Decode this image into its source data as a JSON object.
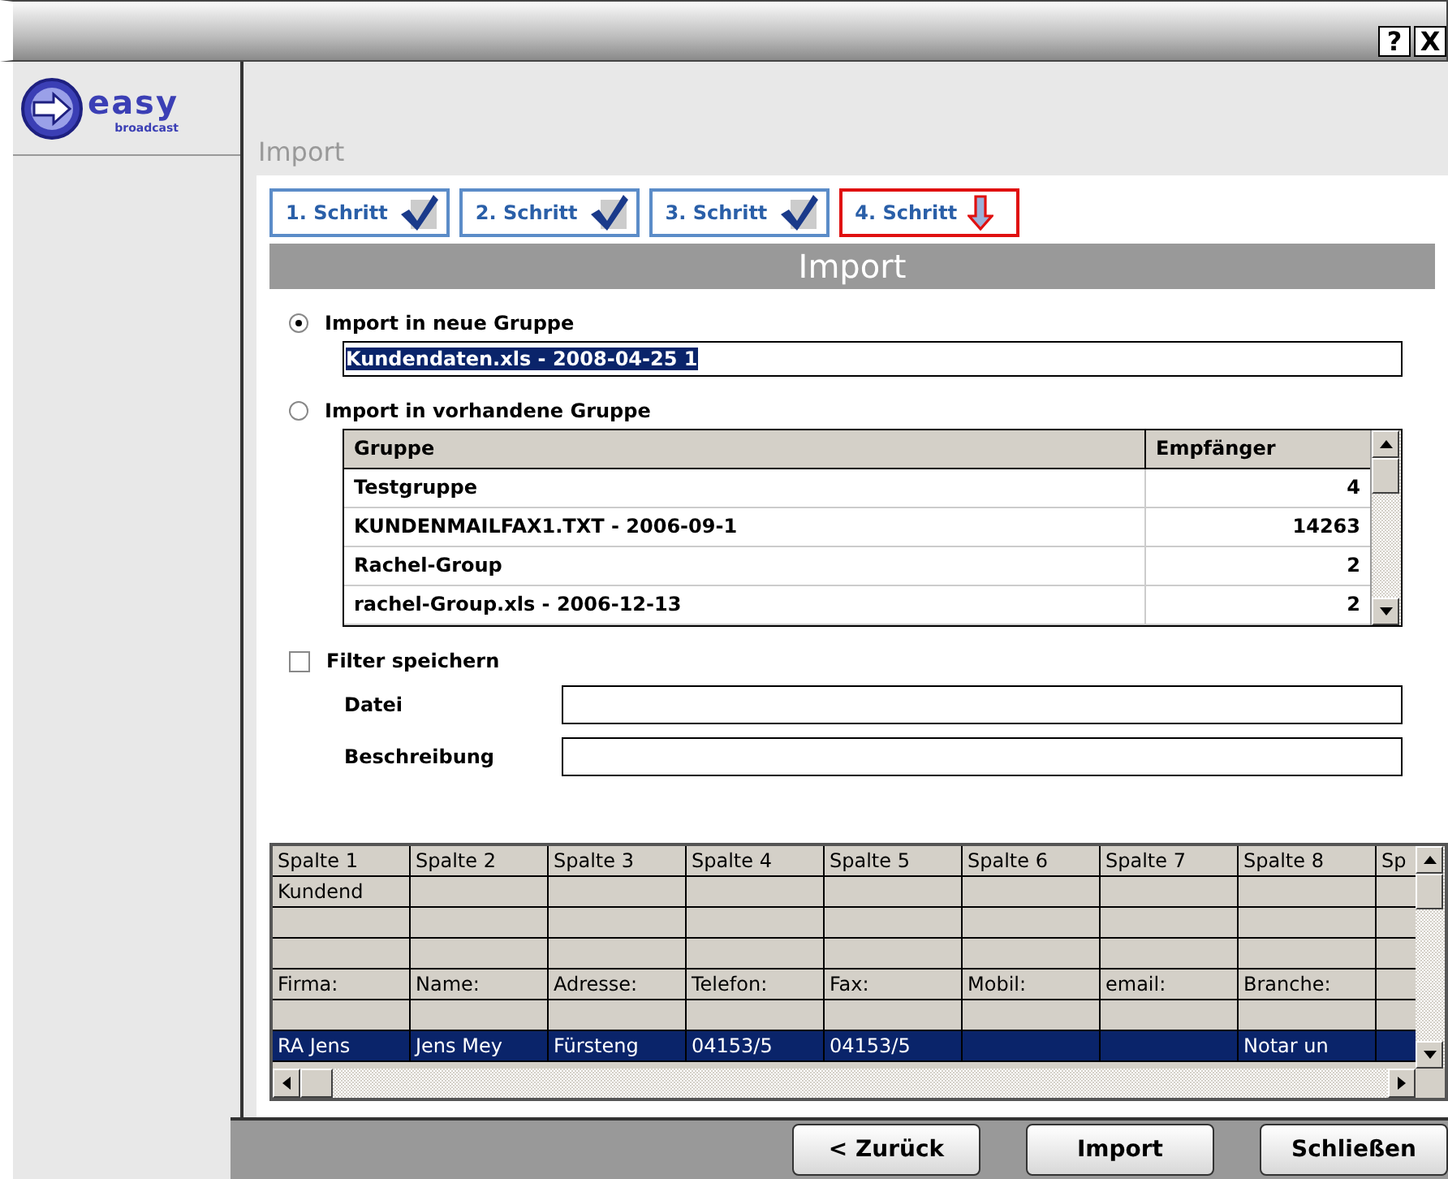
{
  "window": {
    "help_button": "?",
    "close_button": "X"
  },
  "logo": {
    "name": "easy",
    "tagline": "broadcast"
  },
  "page_title": "Import",
  "steps": [
    {
      "label": "1. Schritt",
      "done": true,
      "selected": false
    },
    {
      "label": "2. Schritt",
      "done": true,
      "selected": false
    },
    {
      "label": "3. Schritt",
      "done": true,
      "selected": false
    },
    {
      "label": "4. Schritt",
      "done": false,
      "selected": true
    }
  ],
  "section_title": "Import",
  "new_group": {
    "label": "Import in neue Gruppe",
    "selected": true,
    "value": "Kundendaten.xls - 2008-04-25 1"
  },
  "existing_group": {
    "label": "Import in vorhandene Gruppe",
    "selected": false,
    "columns": [
      "Gruppe",
      "Empfänger"
    ],
    "rows": [
      {
        "name": "Testgruppe",
        "count": "4"
      },
      {
        "name": "KUNDENMAILFAX1.TXT - 2006-09-1",
        "count": "14263"
      },
      {
        "name": "Rachel-Group",
        "count": "2"
      },
      {
        "name": "rachel-Group.xls - 2006-12-13",
        "count": "2"
      }
    ]
  },
  "filter": {
    "label": "Filter speichern",
    "checked": false,
    "fields": [
      {
        "label": "Datei"
      },
      {
        "label": "Beschreibung"
      }
    ]
  },
  "preview": {
    "columns": [
      "Spalte 1",
      "Spalte 2",
      "Spalte 3",
      "Spalte 4",
      "Spalte 5",
      "Spalte 6",
      "Spalte 7",
      "Spalte 8",
      "Sp"
    ],
    "rows": [
      {
        "selected": false,
        "cells": [
          "Kundend",
          "",
          "",
          "",
          "",
          "",
          "",
          "",
          ""
        ]
      },
      {
        "selected": false,
        "cells": [
          "",
          "",
          "",
          "",
          "",
          "",
          "",
          "",
          ""
        ]
      },
      {
        "selected": false,
        "cells": [
          "",
          "",
          "",
          "",
          "",
          "",
          "",
          "",
          ""
        ]
      },
      {
        "selected": false,
        "cells": [
          "Firma:",
          "Name:",
          "Adresse:",
          "Telefon:",
          "Fax:",
          "Mobil:",
          "email:",
          "Branche:",
          ""
        ]
      },
      {
        "selected": false,
        "cells": [
          "",
          "",
          "",
          "",
          "",
          "",
          "",
          "",
          ""
        ]
      },
      {
        "selected": true,
        "cells": [
          "RA Jens",
          "Jens Mey",
          "Fürsteng",
          "04153/5",
          "04153/5",
          "",
          "",
          "Notar un",
          ""
        ]
      }
    ]
  },
  "buttons": [
    {
      "label": "< Zurück"
    },
    {
      "label": "Import"
    },
    {
      "label": "Schließen"
    }
  ]
}
